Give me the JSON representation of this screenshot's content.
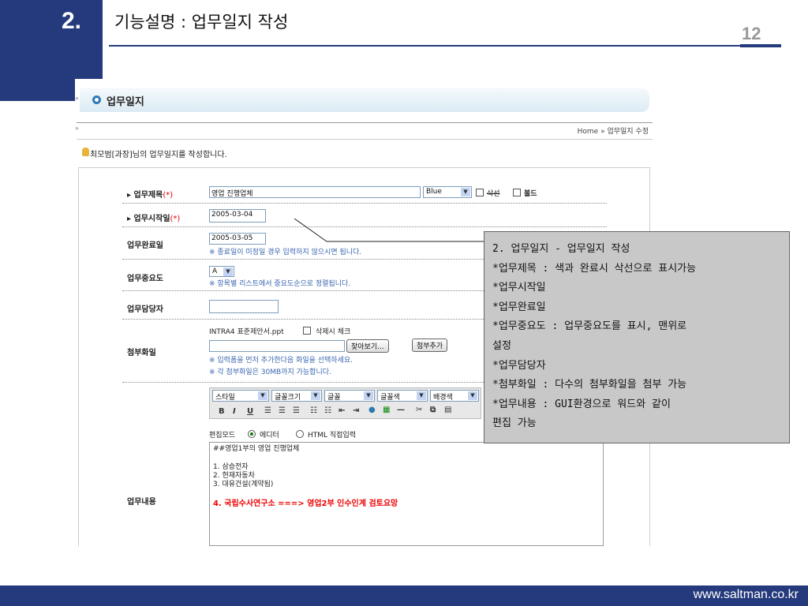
{
  "slide": {
    "section_number": "2.",
    "title": "기능설명 : 업무일지 작성",
    "page_number": "12",
    "footer_url": "www.saltman.co.kr"
  },
  "app": {
    "page_title": "업무일지",
    "breadcrumb": "Home » 업무일지 수정",
    "intro": "최모범[과장]님의 업무일지를 작성합니다."
  },
  "form": {
    "title": {
      "label": "업무제목",
      "required_mark": "(*)",
      "value": "영업 진행업체",
      "color_select": "Blue",
      "strike_label": "삭선",
      "bold_label": "볼드"
    },
    "start_date": {
      "label": "업무시작일",
      "required_mark": "(*)",
      "value": "2005-03-04"
    },
    "end_date": {
      "label": "업무완료일",
      "value": "2005-03-05",
      "note": "※ 종료일이 미정일 경우 입력하지 않으시면 됩니다."
    },
    "importance": {
      "label": "업무중요도",
      "value": "A",
      "note": "※ 항목별 리스트에서 중요도순으로 정렬됩니다."
    },
    "assignee": {
      "label": "업무담당자",
      "value": ""
    },
    "attachment": {
      "label": "첨부화일",
      "existing_file": "INTRA4 표준제안서.ppt",
      "delete_check_label": "삭제시 체크",
      "browse_button": "찾아보기...",
      "add_button": "첨부추가",
      "note1": "※ 입력폼을 먼저 추가한다음 화일을 선택하세요.",
      "note2": "※ 각 첨부화일은 30MB까지 가능합니다."
    },
    "content": {
      "label": "업무내용",
      "toolbar_selects": [
        "스타일",
        "글꼴크기",
        "글꼴",
        "글꼴색",
        "배경색"
      ],
      "edit_mode_label": "편집모드",
      "mode_editor": "에디터",
      "mode_html": "HTML 직접입력",
      "lines": [
        "##영업1부의 영업 진행업체",
        "1. 삼승전자",
        "2. 현재자동차",
        "3. 대유건설(계약됨)"
      ],
      "highlight_line": "4. 국립수사연구소 ===> 영업2부 인수인계 검토요망"
    }
  },
  "callout": {
    "lines": [
      "2. 업무일지 - 업무일지 작성",
      " *업무제목 : 색과 완료시 삭선으로 표시가능",
      " *업무시작일",
      " *업무완료일",
      " *업무중요도 : 업무중요도를 표시, 맨위로",
      "  설정",
      " *업무담당자",
      " *첨부화일 : 다수의 첨부화일을 첨부 가능",
      " *업무내용 : GUI환경으로 워드와 같이",
      "  편집 가능"
    ]
  },
  "colors": {
    "navy": "#243a7c",
    "callout_bg": "#c8c8c8",
    "note_blue": "#3a66b0",
    "highlight_red": "#e00000"
  }
}
